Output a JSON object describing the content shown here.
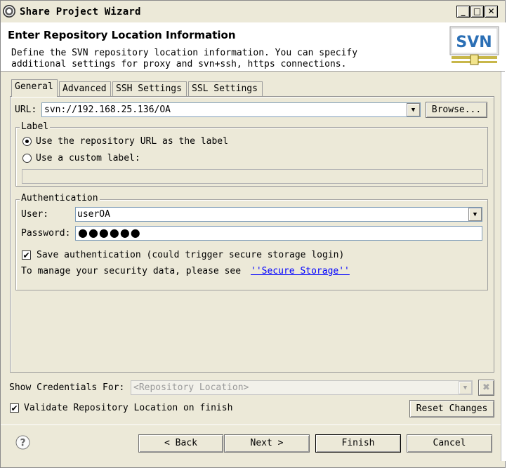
{
  "window": {
    "title": "Share Project Wizard",
    "minimize": "_",
    "maximize": "□",
    "close": "✕"
  },
  "header": {
    "title": "Enter Repository Location Information",
    "description_line1": "Define the SVN repository location information. You can specify",
    "description_line2": "additional settings for proxy and svn+ssh, https connections.",
    "logo_text": "SVN"
  },
  "tabs": [
    {
      "label": "General",
      "active": true
    },
    {
      "label": "Advanced",
      "active": false
    },
    {
      "label": "SSH Settings",
      "active": false
    },
    {
      "label": "SSL Settings",
      "active": false
    }
  ],
  "general": {
    "url_label": "URL:",
    "url_value": "svn://192.168.25.136/OA",
    "browse_label": "Browse...",
    "label_group": {
      "title": "Label",
      "option_repo_url": "Use the repository URL as the label",
      "option_custom": "Use a custom label:",
      "custom_value": ""
    },
    "auth_group": {
      "title": "Authentication",
      "user_label": "User:",
      "user_value": "userOA",
      "password_label": "Password:",
      "password_mask": "●●●●●●",
      "save_auth_label": "Save authentication (could trigger secure storage login)",
      "save_auth_checked": true,
      "manage_text": "To manage your security data, please see",
      "secure_storage_link": "''Secure Storage''"
    }
  },
  "bottom": {
    "show_credentials_label": "Show Credentials For:",
    "show_credentials_value": "<Repository Location>",
    "validate_label": "Validate Repository Location on finish",
    "validate_checked": true,
    "reset_changes_label": "Reset Changes"
  },
  "buttons": {
    "back": "< Back",
    "next": "Next >",
    "finish": "Finish",
    "cancel": "Cancel"
  },
  "icons": {
    "help": "help-icon",
    "logo": "svn-logo-icon"
  }
}
